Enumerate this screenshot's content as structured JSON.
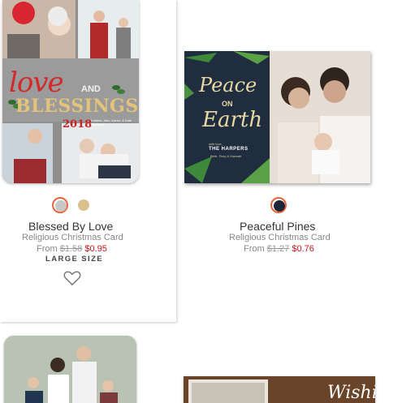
{
  "products": [
    {
      "name": "Blessed By Love",
      "category": "Religious Christmas Card",
      "price_prefix": "From",
      "original_price": "$1.58",
      "sale_price": "$0.95",
      "badge": "LARGE SIZE",
      "swatches": [
        "#c7c7c7",
        "#d9c08e"
      ],
      "selected_swatch": 0,
      "card_text": {
        "love": "love",
        "and": "AND",
        "blessings": "BLESSINGS",
        "year": "2018",
        "names": "Kristine, Alex, Karen, & Kate McCarthy"
      }
    },
    {
      "name": "Peaceful Pines",
      "category": "Religious Christmas Card",
      "price_prefix": "From",
      "original_price": "$1.27",
      "sale_price": "$0.76",
      "swatches": [
        "#1c2638"
      ],
      "selected_swatch": 0,
      "card_text": {
        "peace": "Peace",
        "on": "ON",
        "earth": "Earth",
        "with_love": "with love,",
        "family": "THE HARPERS",
        "names": "Beth, Terry & Hannah"
      }
    }
  ],
  "partial_cards": {
    "third_card_text": "Wishing"
  },
  "colors": {
    "sale_red": "#c4161c",
    "selected_ring": "#e8643c"
  }
}
